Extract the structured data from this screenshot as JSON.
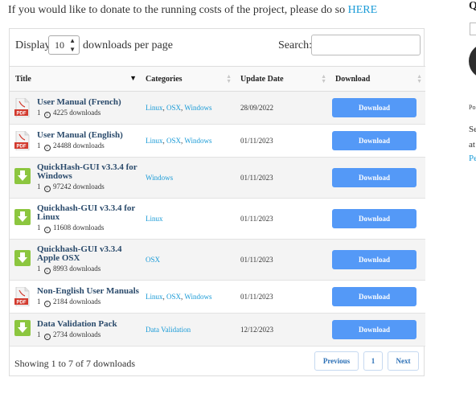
{
  "donate": {
    "text": "If you would like to donate to the running costs of the project, please do so",
    "link": "HERE"
  },
  "toolbar": {
    "display_label": "Display",
    "per_page_value": "10",
    "per_page_label": "downloads per page",
    "search_label": "Search:",
    "search_value": ""
  },
  "table": {
    "columns": [
      "Title",
      "Categories",
      "Update Date",
      "Download"
    ],
    "rows": [
      {
        "icon": "pdf-icon",
        "title": "User Manual (French)",
        "count": "1",
        "downloads": "4225 downloads",
        "categories": [
          "Linux",
          "OSX",
          "Windows"
        ],
        "date": "28/09/2022",
        "button": "Download"
      },
      {
        "icon": "pdf-icon",
        "title": "User Manual (English)",
        "count": "1",
        "downloads": "24488 downloads",
        "categories": [
          "Linux",
          "OSX",
          "Windows"
        ],
        "date": "01/11/2023",
        "button": "Download"
      },
      {
        "icon": "download-arrow-icon",
        "title": "QuickHash-GUI v3.3.4 for Windows",
        "count": "1",
        "downloads": "97242 downloads",
        "categories": [
          "Windows"
        ],
        "date": "01/11/2023",
        "button": "Download"
      },
      {
        "icon": "download-arrow-icon",
        "title": "Quickhash-GUI v3.3.4 for Linux",
        "count": "1",
        "downloads": "11608 downloads",
        "categories": [
          "Linux"
        ],
        "date": "01/11/2023",
        "button": "Download"
      },
      {
        "icon": "download-arrow-icon",
        "title": "Quickhash-GUI v3.3.4 Apple OSX",
        "count": "1",
        "downloads": "8993 downloads",
        "categories": [
          "OSX"
        ],
        "date": "01/11/2023",
        "button": "Download"
      },
      {
        "icon": "pdf-icon",
        "title": "Non-English User Manuals",
        "count": "1",
        "downloads": "2184 downloads",
        "categories": [
          "Linux",
          "OSX",
          "Windows"
        ],
        "date": "01/11/2023",
        "button": "Download"
      },
      {
        "icon": "download-arrow-icon",
        "title": "Data Validation Pack",
        "count": "1",
        "downloads": "2734 downloads",
        "categories": [
          "Data Validation"
        ],
        "date": "12/12/2023",
        "button": "Download"
      }
    ]
  },
  "footer": {
    "summary": "Showing 1 to 7 of 7 downloads",
    "previous": "Previous",
    "page": "1",
    "next": "Next"
  },
  "sidebar_right": {
    "heading": "Q",
    "po": "Po",
    "se": "Se",
    "at": "at",
    "pe": "Pe"
  },
  "colors": {
    "accent": "#5499f7",
    "link": "#1a9bd7",
    "pdf_red": "#d23a2e",
    "download_green": "#8cc63f"
  }
}
